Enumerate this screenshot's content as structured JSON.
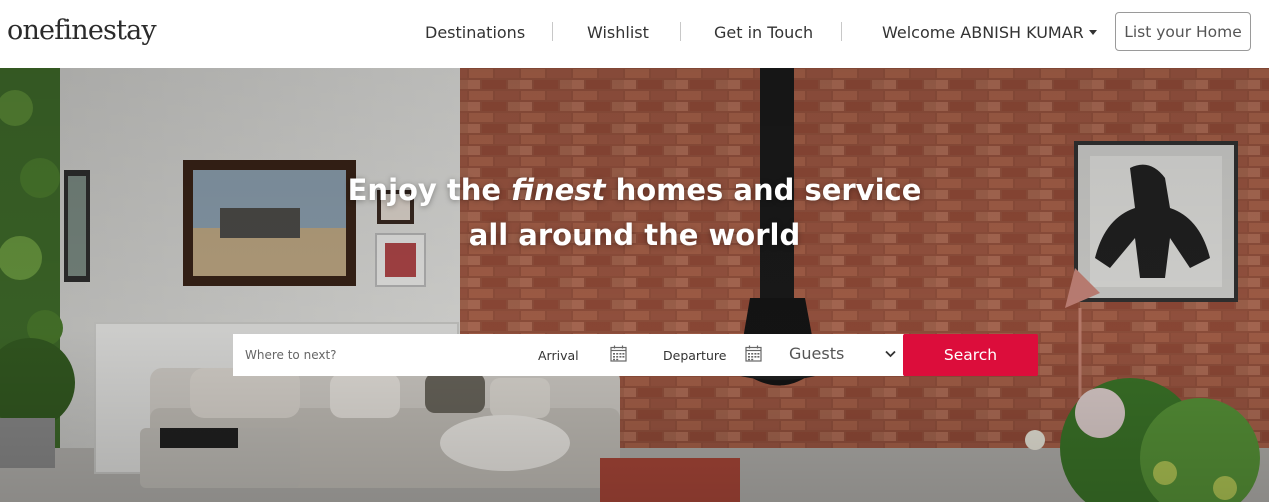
{
  "header": {
    "logo": "onefinestay",
    "nav": {
      "destinations": "Destinations",
      "wishlist": "Wishlist",
      "get_in_touch": "Get in Touch",
      "welcome": "Welcome ABNISH KUMAR"
    },
    "list_home_label": "List your Home"
  },
  "hero": {
    "title_part1": "Enjoy the ",
    "title_emphasis": "finest",
    "title_part2": " homes and service",
    "title_line2": "all around the world"
  },
  "search": {
    "where_placeholder": "Where to next?",
    "arrival_label": "Arrival",
    "departure_label": "Departure",
    "guests_value": "Guests",
    "search_label": "Search"
  },
  "icons": {
    "arrival_calendar": "calendar-icon",
    "departure_calendar": "calendar-icon",
    "guests_dropdown": "chevron-down-icon",
    "welcome_dropdown": "caret-down-icon"
  },
  "colors": {
    "accent": "#dc0d3b",
    "text": "#333333",
    "brick": "#a8604a",
    "wall": "#dcdcda"
  }
}
